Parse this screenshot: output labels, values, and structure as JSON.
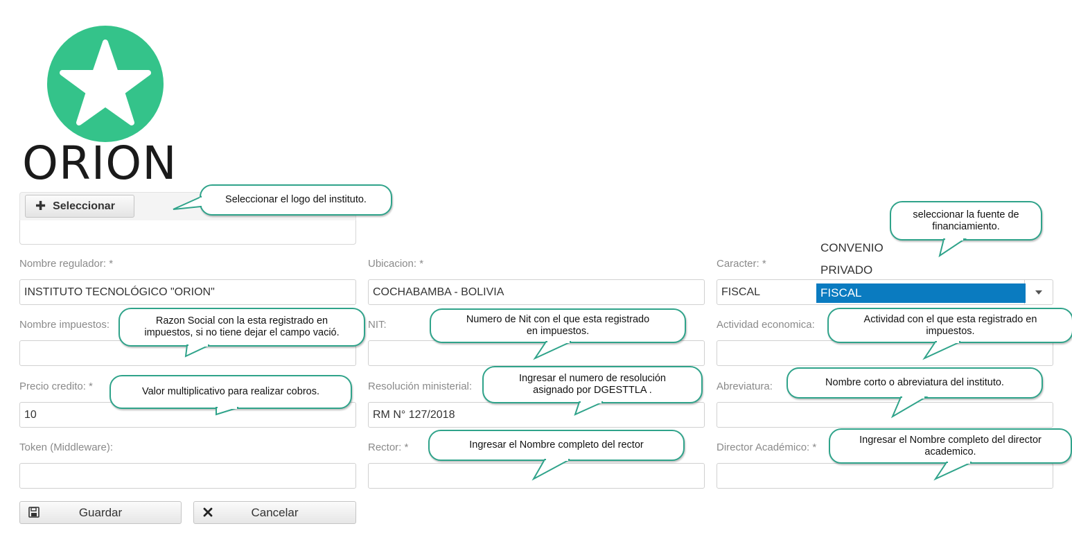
{
  "logo": {
    "text": "ORION",
    "circle_color": "#34c38a"
  },
  "upload": {
    "select_label": "Seleccionar"
  },
  "form": {
    "nombre_regulador": {
      "label": "Nombre regulador: *",
      "value": "INSTITUTO TECNOLÓGICO  \"ORION\""
    },
    "ubicacion": {
      "label": "Ubicacion: *",
      "value": "COCHABAMBA - BOLIVIA"
    },
    "caracter": {
      "label": "Caracter: *",
      "value": "FISCAL",
      "options": [
        "CONVENIO",
        "PRIVADO",
        "FISCAL"
      ]
    },
    "nombre_impuestos": {
      "label": "Nombre impuestos:",
      "value": ""
    },
    "nit": {
      "label": "NIT:",
      "value": ""
    },
    "actividad": {
      "label": "Actividad economica:",
      "value": ""
    },
    "precio_credito": {
      "label": "Precio credito: *",
      "value": "10"
    },
    "resolucion": {
      "label": "Resolución ministerial:",
      "value": "RM N° 127/2018"
    },
    "abreviatura": {
      "label": "Abreviatura:",
      "value": ""
    },
    "token": {
      "label": "Token (Middleware):",
      "value": ""
    },
    "rector": {
      "label": "Rector: *",
      "value": ""
    },
    "director": {
      "label": "Director Académico: *",
      "value": ""
    }
  },
  "actions": {
    "save_label": "Guardar",
    "cancel_label": "Cancelar"
  },
  "callouts": {
    "logo": "Seleccionar el logo del instituto.",
    "fuente": "seleccionar la fuente de\nfinanciamiento.",
    "razon_social": "Razon  Social con la esta registrado en\nimpuestos, si no tiene dejar el campo vació.",
    "nit": "Numero de Nit con el que esta registrado\nen impuestos.",
    "actividad": "Actividad con el que esta registrado en\nimpuestos.",
    "precio": "Valor multiplicativo para realizar cobros.",
    "resolucion": "Ingresar el numero de resolución\nasignado por DGESTTLA  .",
    "abreviatura": "Nombre corto o abreviatura del instituto.",
    "rector": "Ingresar el Nombre completo  del rector",
    "director": "Ingresar el Nombre completo  del director\nacademico."
  },
  "colors": {
    "accent": "#2fa38a",
    "selected": "#0a7bc0"
  }
}
